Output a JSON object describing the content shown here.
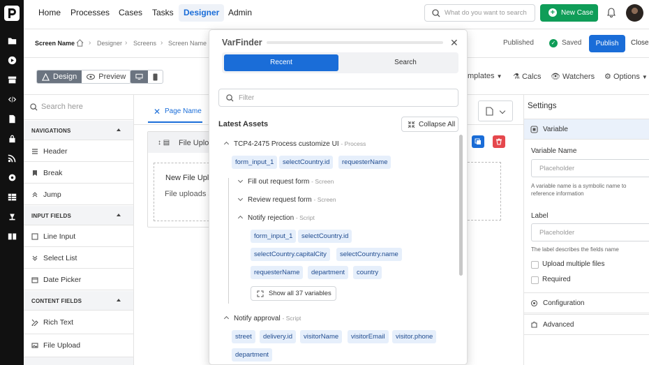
{
  "nav": {
    "items": [
      "Home",
      "Processes",
      "Cases",
      "Tasks",
      "Designer",
      "Admin"
    ],
    "active": "Designer",
    "search_placeholder": "What do you want to search",
    "new_case_label": "New Case"
  },
  "breadcrumb": {
    "items": [
      "Screen Name",
      "Designer",
      "Screens",
      "Screen Name"
    ]
  },
  "header": {
    "status": "Published",
    "saved": "Saved",
    "publish_label": "Publish",
    "close_label": "Close"
  },
  "toolbar": {
    "design": "Design",
    "preview": "Preview",
    "templates": "mplates",
    "calcs": "Calcs",
    "watchers": "Watchers",
    "options": "Options"
  },
  "leftpanel": {
    "search_placeholder": "Search here",
    "sections": [
      {
        "title": "NAVIGATIONS",
        "items": [
          "Header",
          "Break",
          "Jump"
        ]
      },
      {
        "title": "INPUT FIELDS",
        "items": [
          "Line Input",
          "Select List",
          "Date Picker"
        ]
      },
      {
        "title": "CONTENT FIELDS",
        "items": [
          "Rich Text",
          "File Upload"
        ]
      }
    ]
  },
  "canvas": {
    "tab_label": "Page Name",
    "card_title": "File Uploa",
    "drop_title": "New File Uplo",
    "drop_text": "File uploads a"
  },
  "settings": {
    "title": "Settings",
    "variable_section": "Variable",
    "variable_name_label": "Variable Name",
    "variable_placeholder": "Placeholder",
    "variable_help": "A variable name is a symbolic name to reference information",
    "label_label": "Label",
    "label_placeholder": "Placeholder",
    "label_help": "The label describes the fields name",
    "upload_multiple": "Upload multiple files",
    "required": "Required",
    "configuration": "Configuration",
    "advanced": "Advanced"
  },
  "varfinder": {
    "title": "VarFinder",
    "tabs": [
      "Recent",
      "Search"
    ],
    "filter_placeholder": "Filter",
    "latest_assets": "Latest Assets",
    "collapse_all": "Collapse All",
    "process": {
      "name": "TCP4-2475 Process customize UI",
      "type": "Process"
    },
    "process_vars": [
      "form_input_1",
      "selectCountry.id",
      "requesterName"
    ],
    "screen1": {
      "name": "Fill out request form",
      "type": "Screen"
    },
    "screen2": {
      "name": "Review request form",
      "type": "Screen"
    },
    "script1": {
      "name": "Notify rejection",
      "type": "Script"
    },
    "script1_vars": [
      "form_input_1",
      "selectCountry.id",
      "selectCountry.capitalCity",
      "selectCountry.name",
      "requesterName",
      "department",
      "country"
    ],
    "show_all": "Show all 37 variables",
    "script2": {
      "name": "Notify approval",
      "type": "Script"
    },
    "script2_vars": [
      "street",
      "delivery.id",
      "visitorName",
      "visitorEmail",
      "visitor.phone",
      "department"
    ]
  },
  "colors": {
    "accent": "#1a6dd8",
    "success": "#0f9d58",
    "danger": "#e5484d",
    "sidebar": "#111111"
  }
}
